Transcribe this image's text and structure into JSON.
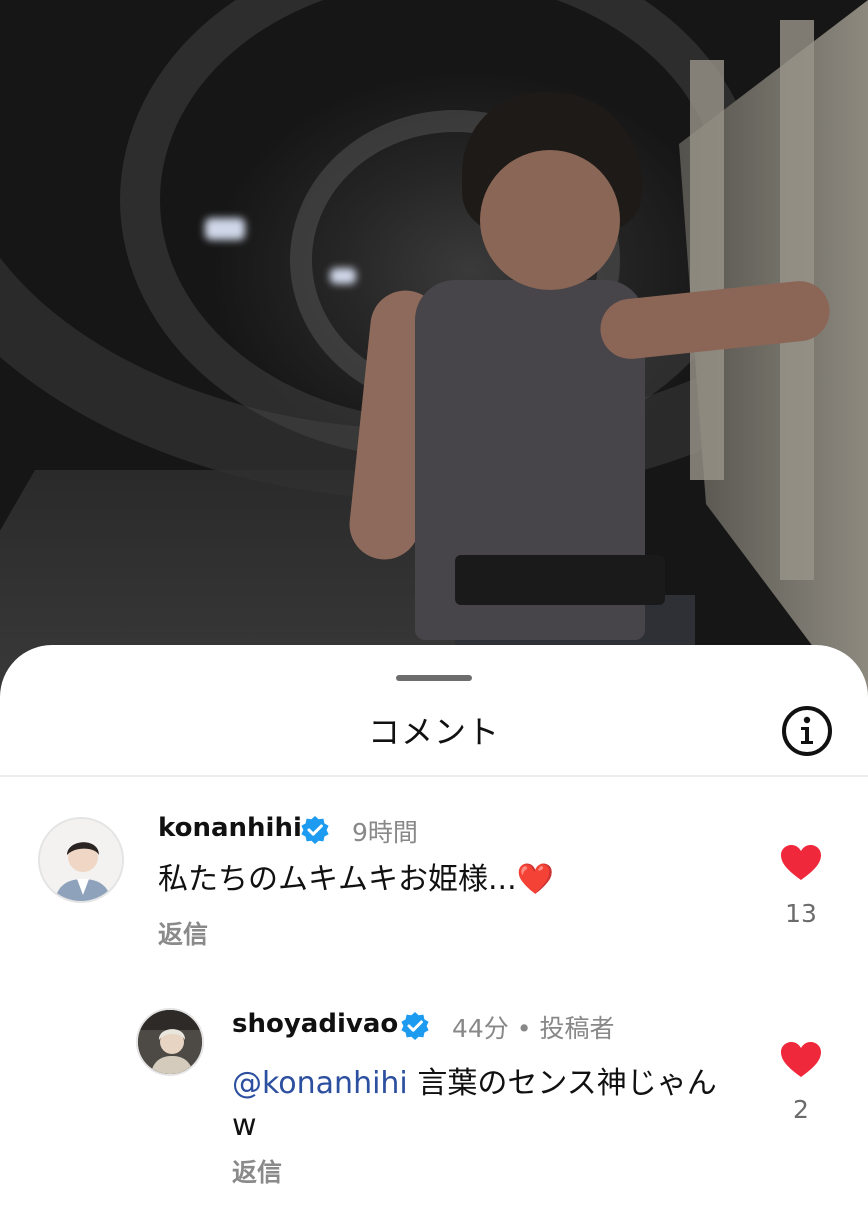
{
  "sheet": {
    "title": "コメント"
  },
  "icons": {
    "info": "info-icon",
    "verified": "verified-badge-icon",
    "like": "heart-icon",
    "heart_emoji": "❤️"
  },
  "colors": {
    "like_red": "#f0283c",
    "verified_blue": "#1d9bf0",
    "mention_blue": "#2c4f9f",
    "secondary_gray": "#888888"
  },
  "comments": [
    {
      "username": "konanhihi",
      "time": "9時間",
      "text": "私たちのムキムキお姫様...",
      "emoji": "❤️",
      "reply_label": "返信",
      "likes": "13"
    },
    {
      "username": "shoyadivao",
      "time": "44分",
      "separator": "•",
      "author_label": "投稿者",
      "mention": "@konanhihi",
      "text": " 言葉のセンス神じゃんw",
      "reply_label": "返信",
      "likes": "2"
    }
  ]
}
